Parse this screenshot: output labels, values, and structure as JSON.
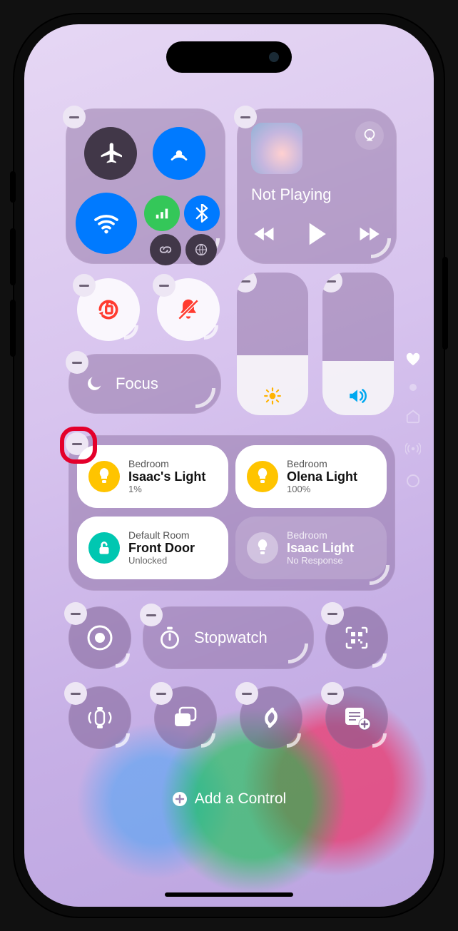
{
  "connectivity": {
    "airplane_name": "airplane",
    "airdrop_name": "airdrop",
    "wifi_name": "wifi",
    "cellular_name": "cellular",
    "bluetooth_name": "bluetooth",
    "vpn_name": "vpn",
    "hotspot_name": "hotspot"
  },
  "media": {
    "status": "Not Playing"
  },
  "focus": {
    "label": "Focus"
  },
  "brightness": {
    "level_pct": 42
  },
  "volume": {
    "level_pct": 38
  },
  "home": {
    "tiles": [
      {
        "room": "Bedroom",
        "name": "Isaac's Light",
        "sub": "1%"
      },
      {
        "room": "Bedroom",
        "name": "Olena Light",
        "sub": "100%"
      },
      {
        "room": "Default Room",
        "name": "Front Door",
        "sub": "Unlocked"
      },
      {
        "room": "Bedroom",
        "name": "Isaac Light",
        "sub": "No Response"
      }
    ]
  },
  "stopwatch": {
    "label": "Stopwatch"
  },
  "footer": {
    "add_label": "Add a Control"
  }
}
